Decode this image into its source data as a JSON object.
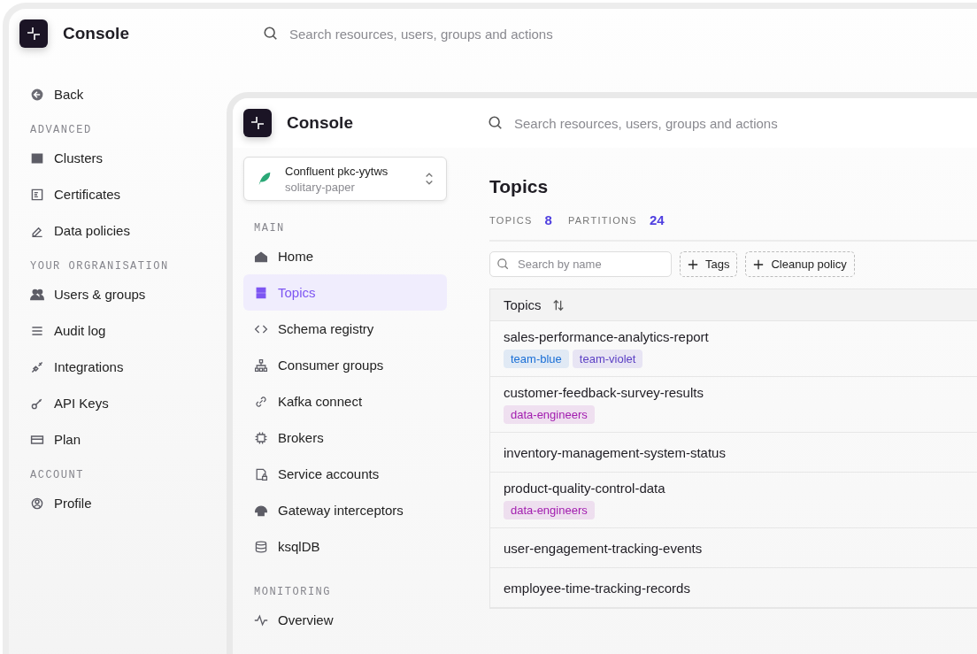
{
  "back_window": {
    "title": "Console",
    "search": {
      "placeholder": "Search resources, users, groups and actions"
    },
    "back_link": "Back",
    "sections": [
      {
        "heading": "ADVANCED",
        "items": [
          {
            "label": "Clusters",
            "selected": false
          },
          {
            "label": "Certificates",
            "selected": false
          },
          {
            "label": "Data policies",
            "selected": false
          }
        ]
      },
      {
        "heading": "YOUR ORGRANISATION",
        "items": [
          {
            "label": "Users & groups",
            "selected": false
          },
          {
            "label": "Audit log",
            "selected": false
          },
          {
            "label": "Integrations",
            "selected": false
          },
          {
            "label": "API Keys",
            "selected": false
          },
          {
            "label": "Plan",
            "selected": false
          }
        ]
      },
      {
        "heading": "ACCOUNT",
        "items": [
          {
            "label": "Profile",
            "selected": false
          }
        ]
      }
    ]
  },
  "front_window": {
    "title": "Console",
    "search": {
      "placeholder": "Search resources, users, groups and actions"
    },
    "cluster": {
      "name": "Confluent pkc-yytws",
      "subtitle": "solitary-paper"
    },
    "sections": [
      {
        "heading": "MAIN",
        "items": [
          {
            "label": "Home",
            "selected": false
          },
          {
            "label": "Topics",
            "selected": true
          },
          {
            "label": "Schema registry",
            "selected": false
          },
          {
            "label": "Consumer groups",
            "selected": false
          },
          {
            "label": "Kafka connect",
            "selected": false
          },
          {
            "label": "Brokers",
            "selected": false
          },
          {
            "label": "Service accounts",
            "selected": false
          },
          {
            "label": "Gateway interceptors",
            "selected": false
          },
          {
            "label": "ksqlDB",
            "selected": false
          }
        ]
      },
      {
        "heading": "MONITORING",
        "items": [
          {
            "label": "Overview",
            "selected": false
          }
        ]
      }
    ],
    "page_title": "Topics",
    "stats": [
      {
        "label": "TOPICS",
        "value": "8"
      },
      {
        "label": "PARTITIONS",
        "value": "24"
      }
    ],
    "filter": {
      "placeholder": "Search by name"
    },
    "filter_buttons": [
      "Tags",
      "Cleanup policy"
    ],
    "table": {
      "columns": [
        "Topics"
      ],
      "rows": [
        {
          "name": "sales-performance-analytics-report",
          "tags": [
            {
              "label": "team-blue",
              "color": "#1a6fd6"
            },
            {
              "label": "team-violet",
              "color": "#5b3fc4"
            }
          ]
        },
        {
          "name": "customer-feedback-survey-results",
          "tags": [
            {
              "label": "data-engineers",
              "color": "#a21caf"
            }
          ]
        },
        {
          "name": "inventory-management-system-status",
          "tags": []
        },
        {
          "name": "product-quality-control-data",
          "tags": [
            {
              "label": "data-engineers",
              "color": "#a21caf"
            }
          ]
        },
        {
          "name": "user-engagement-tracking-events",
          "tags": []
        },
        {
          "name": "employee-time-tracking-records",
          "tags": []
        }
      ]
    }
  }
}
